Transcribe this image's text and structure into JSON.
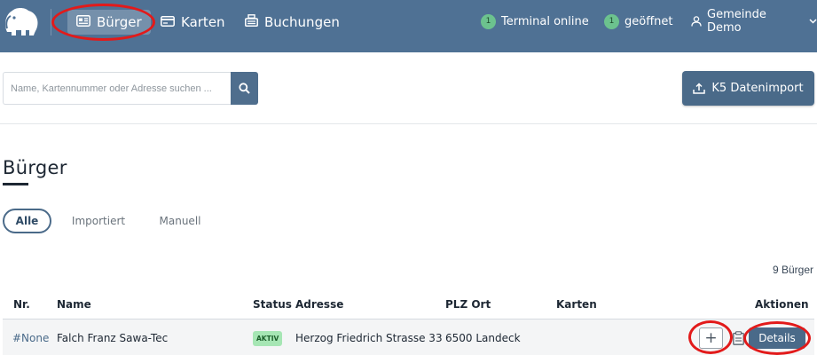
{
  "nav": {
    "items": [
      {
        "label": "Bürger",
        "icon": "id-card-icon"
      },
      {
        "label": "Karten",
        "icon": "card-icon"
      },
      {
        "label": "Buchungen",
        "icon": "cash-register-icon"
      }
    ],
    "status": [
      {
        "count": "1",
        "label": "Terminal online"
      },
      {
        "count": "1",
        "label": "geöffnet"
      }
    ],
    "user": {
      "label": "Gemeinde Demo",
      "icon": "user-icon"
    }
  },
  "search": {
    "placeholder": "Name, Kartennummer oder Adresse suchen ...",
    "value": ""
  },
  "import_button": {
    "label": "K5 Datenimport"
  },
  "page": {
    "title": "Bürger"
  },
  "filters": [
    "Alle",
    "Importiert",
    "Manuell"
  ],
  "count_text": "9 Bürger",
  "table": {
    "headers": [
      "Nr.",
      "Name",
      "Status",
      "Adresse",
      "PLZ Ort",
      "Karten",
      "Aktionen"
    ],
    "rows": [
      {
        "nr": "#None",
        "name": "Falch Franz Sawa-Tec",
        "status": "AKTIV",
        "adresse": "Herzog Friedrich Strasse 33",
        "plz_ort": "6500 Landeck",
        "karten": "",
        "plus": "+",
        "details": "Details"
      }
    ]
  },
  "colors": {
    "nav_bg": "#4f7194",
    "primary": "#4a6a89",
    "badge_green": "#a6e6b4",
    "annotation_red": "#e21a1a"
  }
}
